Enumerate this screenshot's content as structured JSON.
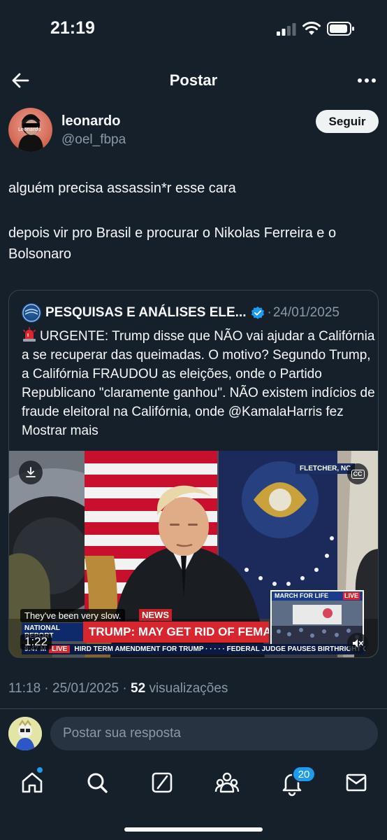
{
  "status_bar": {
    "time": "21:19"
  },
  "topbar": {
    "title": "Postar"
  },
  "author": {
    "display_name": "leonardo",
    "handle": "@oel_fbpa",
    "follow_label": "Seguir"
  },
  "tweet": {
    "paragraphs": [
      "alguém precisa assassin*r esse cara",
      "depois vir pro Brasil e procurar o Nikolas Ferreira e o Bolsonaro"
    ]
  },
  "quote": {
    "account_name": "PESQUISAS E ANÁLISES ELE...",
    "separator": "·",
    "date": "24/01/2025",
    "body": "URGENTE: Trump disse que NÃO vai ajudar a Califórnia a se recuperar das queimadas. O motivo? Segundo Trump, a Califórnia FRAUDOU as eleições, onde o Partido Republicano \"claramente ganhou\". NÃO existem indícios de fraude eleitoral na Califórnia, onde @KamalaHarris fez",
    "show_more": "Mostrar mais",
    "video": {
      "location": "FLETCHER, NC",
      "cc_label": "CC",
      "caption": "They've been very slow.",
      "headline": "TRUMP: MAY GET RID OF FEMA",
      "news_suffix": "NEWS",
      "network_label": "NATIONAL REPORT",
      "ticker_live": "LIVE",
      "ticker_text": "HIRD TERM AMENDMENT FOR TRUMP · · · · · FEDERAL JUDGE PAUSES BIRTHRIGHT CITI",
      "ticker_time": "9:47 M",
      "inset_title": "MARCH FOR LIFE",
      "inset_live": "LIVE",
      "duration": "1:22"
    }
  },
  "meta": {
    "time": "11:18",
    "separator": "·",
    "date": "25/01/2025",
    "views_count": "52",
    "views_label": "visualizações"
  },
  "reply": {
    "placeholder": "Postar sua resposta"
  },
  "tabbar": {
    "notifications_badge": "20"
  },
  "colors": {
    "background": "#15202b",
    "accent": "#1d9bf0",
    "muted_text": "#8b98a5",
    "border": "#38444d",
    "headline_red": "#d7262e"
  }
}
